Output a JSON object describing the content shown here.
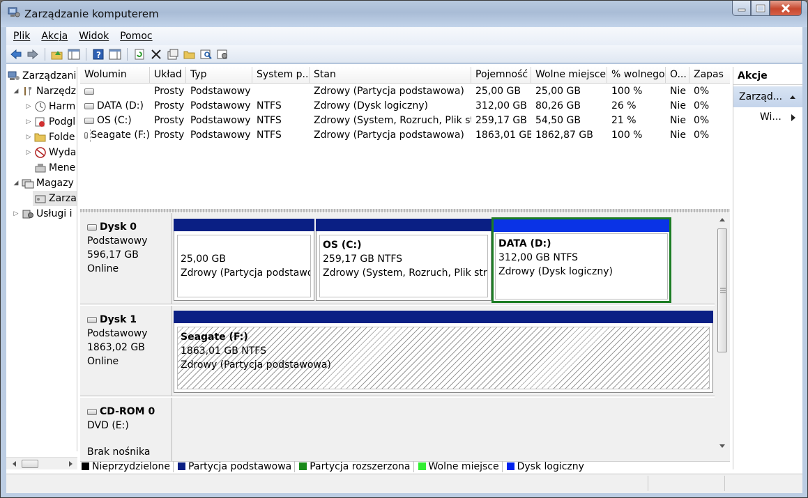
{
  "window": {
    "title": "Zarządzanie komputerem"
  },
  "menu": [
    "Plik",
    "Akcja",
    "Widok",
    "Pomoc"
  ],
  "toolbar_icons": [
    "back-arrow-icon",
    "forward-arrow-icon",
    "up-folder-icon",
    "show-hide-tree-icon",
    "help-icon",
    "show-hide-action-pane-icon",
    "refresh-icon",
    "delete-icon",
    "properties-icon",
    "open-icon",
    "search-icon",
    "settings-icon"
  ],
  "tree": [
    {
      "label": "Zarządzanie",
      "icon": "computer-management-icon",
      "expander": ""
    },
    {
      "label": "Narzędzia",
      "icon": "tools-icon",
      "expander": "◢"
    },
    {
      "label": "Harm",
      "icon": "clock-icon",
      "expander": "▷"
    },
    {
      "label": "Podgl",
      "icon": "event-viewer-icon",
      "expander": "▷"
    },
    {
      "label": "Folde",
      "icon": "shared-folder-icon",
      "expander": "▷"
    },
    {
      "label": "Wyda",
      "icon": "performance-icon",
      "expander": "▷"
    },
    {
      "label": "Mene",
      "icon": "device-manager-icon",
      "expander": ""
    },
    {
      "label": "Magazy",
      "icon": "storage-icon",
      "expander": "◢"
    },
    {
      "label": "Zarza",
      "icon": "disk-management-icon",
      "expander": ""
    },
    {
      "label": "Usługi i",
      "icon": "services-icon",
      "expander": "▷"
    }
  ],
  "columns": [
    "Wolumin",
    "Układ",
    "Typ",
    "System p...",
    "Stan",
    "Pojemność",
    "Wolne miejsce",
    "% wolnego",
    "O...",
    "Zapas"
  ],
  "volumes": [
    [
      "",
      "Prosty",
      "Podstawowy",
      "",
      "Zdrowy (Partycja podstawowa)",
      "25,00 GB",
      "25,00 GB",
      "100 %",
      "Nie",
      "0%"
    ],
    [
      "DATA (D:)",
      "Prosty",
      "Podstawowy",
      "NTFS",
      "Zdrowy (Dysk logiczny)",
      "312,00 GB",
      "80,26 GB",
      "26 %",
      "Nie",
      "0%"
    ],
    [
      "OS (C:)",
      "Prosty",
      "Podstawowy",
      "NTFS",
      "Zdrowy (System, Rozruch, Plik st...",
      "259,17 GB",
      "54,50 GB",
      "21 %",
      "Nie",
      "0%"
    ],
    [
      "Seagate (F:)",
      "Prosty",
      "Podstawowy",
      "NTFS",
      "Zdrowy (Partycja podstawowa)",
      "1863,01 GB",
      "1862,87 GB",
      "100 %",
      "Nie",
      "0%"
    ]
  ],
  "disks": {
    "disk0": {
      "name": "Dysk 0",
      "type": "Podstawowy",
      "size": "596,17 GB",
      "status": "Online"
    },
    "disk1": {
      "name": "Dysk 1",
      "type": "Podstawowy",
      "size": "1863,02 GB",
      "status": "Online"
    },
    "cdrom": {
      "name": "CD-ROM 0",
      "type": "DVD (E:)",
      "status": "Brak nośnika"
    }
  },
  "partitions": {
    "p0a": {
      "name": "",
      "size": "25,00 GB",
      "status": "Zdrowy (Partycja podstawow"
    },
    "p0b": {
      "name": "OS  (C:)",
      "size": "259,17 GB NTFS",
      "status": "Zdrowy (System, Rozruch, Plik stroni"
    },
    "p0c": {
      "name": "DATA  (D:)",
      "size": "312,00 GB NTFS",
      "status": "Zdrowy (Dysk logiczny)"
    },
    "p1a": {
      "name": "Seagate  (F:)",
      "size": "1863,01 GB NTFS",
      "status": "Zdrowy (Partycja podstawowa)"
    }
  },
  "legend": [
    {
      "label": "Nieprzydzielone",
      "color": "#000000"
    },
    {
      "label": "Partycja podstawowa",
      "color": "#0a1f84"
    },
    {
      "label": "Partycja rozszerzona",
      "color": "#1a8a1a"
    },
    {
      "label": "Wolne miejsce",
      "color": "#33ee33"
    },
    {
      "label": "Dysk logiczny",
      "color": "#0022ee"
    }
  ],
  "actions": {
    "header": "Akcje",
    "section": "Zarząd...",
    "item": "Wi..."
  },
  "colors": {
    "primary_partition": "#0a1f84",
    "logical_drive": "#0a33e6",
    "selected_border": "#1d7d24"
  }
}
